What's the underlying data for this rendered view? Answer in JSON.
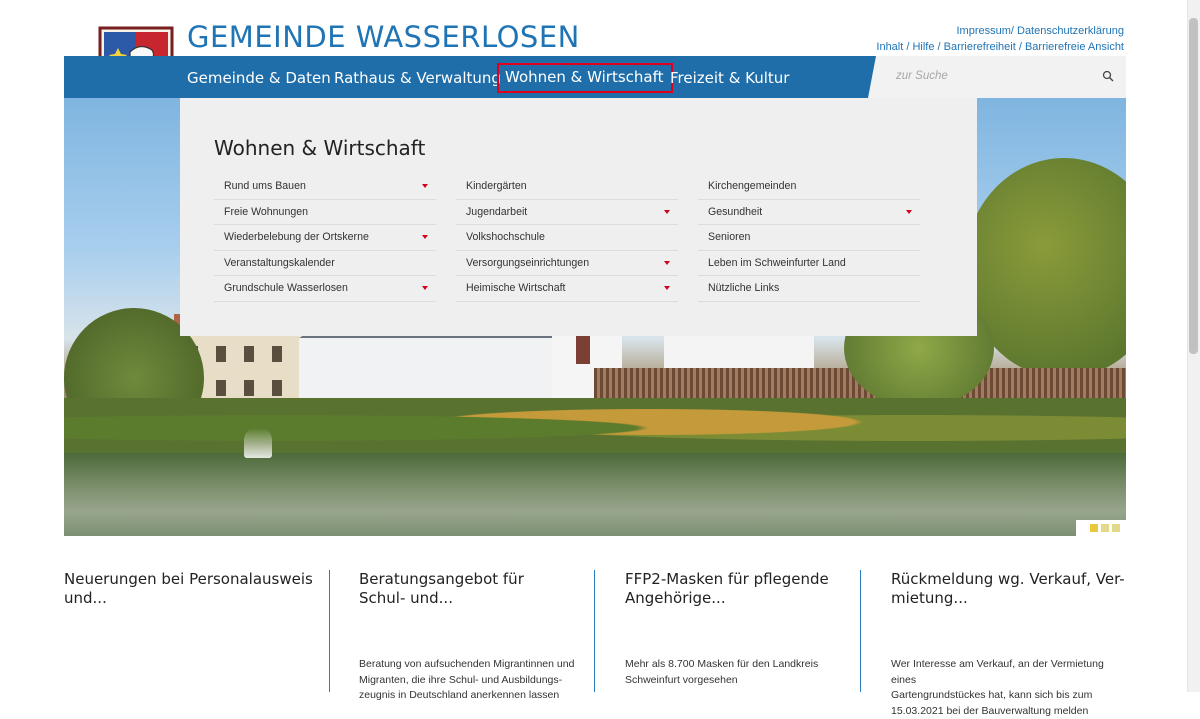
{
  "header": {
    "site_title": "GEMEINDE WASSERLOSEN",
    "toplinks_line1": "Impressum/ Datenschutzerklärung",
    "toplinks_line2": "Inhalt / Hilfe / Barrierefreiheit / Barrierefreie Ansicht"
  },
  "nav": {
    "items": [
      {
        "label": "Gemeinde & Daten"
      },
      {
        "label": "Rathaus & Verwaltung"
      },
      {
        "label": "Wohnen & Wirtschaft"
      },
      {
        "label": "Freizeit & Kultur"
      }
    ],
    "search_placeholder": "zur Suche"
  },
  "mega_menu": {
    "title": "Wohnen & Wirtschaft",
    "col1": [
      {
        "label": "Rund ums Bauen",
        "sub": true
      },
      {
        "label": "Freie Wohnungen",
        "sub": false
      },
      {
        "label": "Wiederbelebung der Ortskerne",
        "sub": true
      },
      {
        "label": "Veranstaltungskalender",
        "sub": false
      },
      {
        "label": "Grundschule Wasserlosen",
        "sub": true
      }
    ],
    "col2": [
      {
        "label": "Kindergärten",
        "sub": false
      },
      {
        "label": "Jugendarbeit",
        "sub": true
      },
      {
        "label": "Volkshochschule",
        "sub": false
      },
      {
        "label": "Versorgungseinrichtungen",
        "sub": true
      },
      {
        "label": "Heimische Wirtschaft",
        "sub": true
      }
    ],
    "col3": [
      {
        "label": "Kirchengemeinden",
        "sub": false
      },
      {
        "label": "Gesundheit",
        "sub": true
      },
      {
        "label": "Senioren",
        "sub": false
      },
      {
        "label": "Leben im Schweinfurter Land",
        "sub": false
      },
      {
        "label": "Nützliche Links",
        "sub": false
      }
    ]
  },
  "slider": {
    "dots": 3,
    "active": 1
  },
  "news": [
    {
      "title_l1": "Neuerungen bei Personalausweis",
      "title_l2": "und...",
      "text_l1": "",
      "text_l2": "",
      "text_l3": ""
    },
    {
      "title_l1": "Beratungsangebot für",
      "title_l2": "Schul- und...",
      "text_l1": "Beratung von aufsuchenden Migrantinnen und",
      "text_l2": "Migranten, die ihre Schul- und Ausbildungs-",
      "text_l3": "zeugnis in Deutschland anerkennen lassen"
    },
    {
      "title_l1": "FFP2-Masken für pflegende",
      "title_l2": "Angehörige...",
      "text_l1": "Mehr als 8.700 Masken für den Landkreis",
      "text_l2": "Schweinfurt vorgesehen",
      "text_l3": ""
    },
    {
      "title_l1": "Rückmeldung wg. Verkauf, Ver-",
      "title_l2": "mietung...",
      "text_l1": "Wer Interesse am Verkauf, an der Vermietung eines",
      "text_l2": "Gartengrundstückes hat, kann sich bis zum",
      "text_l3": "15.03.2021 bei der Bauverwaltung melden"
    }
  ],
  "colors": {
    "brand": "#1f74b5",
    "nav_bg": "#1f6ea9",
    "active_outline": "#e0001b",
    "caret": "#d0021b"
  }
}
